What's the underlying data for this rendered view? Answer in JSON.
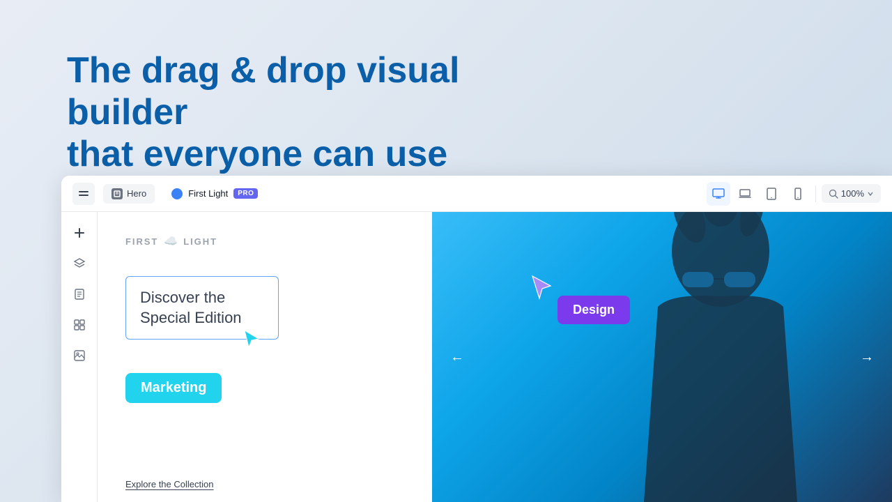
{
  "hero": {
    "title_line1": "The drag & drop visual builder",
    "title_line2": "that everyone can use"
  },
  "toolbar": {
    "menu_label": "menu",
    "page_label": "Hero",
    "site_name": "First Light",
    "pro_label": "PRO",
    "zoom_label": "100%",
    "views": [
      {
        "id": "desktop",
        "label": "Desktop view",
        "icon": "desktop"
      },
      {
        "id": "laptop",
        "label": "Laptop view",
        "icon": "laptop"
      },
      {
        "id": "tablet",
        "label": "Tablet view",
        "icon": "tablet"
      },
      {
        "id": "mobile",
        "label": "Mobile view",
        "icon": "mobile"
      }
    ]
  },
  "sidebar": {
    "items": [
      {
        "id": "add",
        "label": "Add element"
      },
      {
        "id": "layers",
        "label": "Layers"
      },
      {
        "id": "pages",
        "label": "Pages"
      },
      {
        "id": "components",
        "label": "Components"
      },
      {
        "id": "assets",
        "label": "Assets"
      }
    ]
  },
  "canvas": {
    "logo_text_first": "FIRST",
    "logo_text_light": "LIGHT",
    "discover_text": "Discover the Special Edition",
    "marketing_label": "Marketing",
    "explore_text": "Explore the Collection",
    "design_badge": "Design",
    "carousel_arrow_left": "←",
    "carousel_arrow_right": "→"
  }
}
